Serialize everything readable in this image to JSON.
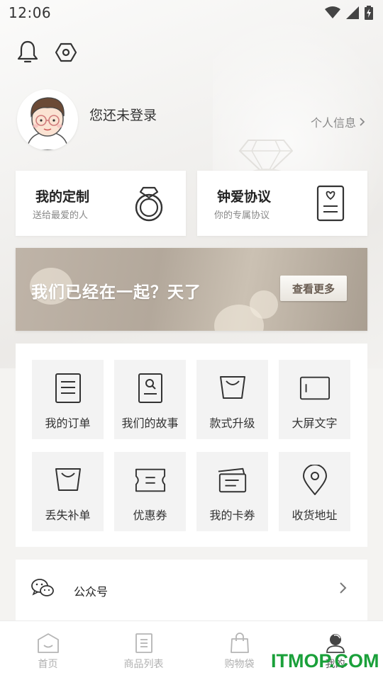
{
  "status_bar": {
    "time": "12:06",
    "icons": [
      "wifi-icon",
      "signal-icon",
      "battery-charging-icon"
    ]
  },
  "header": {
    "icons": [
      "bell-icon",
      "settings-hexagon-icon"
    ]
  },
  "profile": {
    "login_text": "您还未登录",
    "personal_info_label": "个人信息",
    "personal_info_icon": "chevron-right-icon"
  },
  "cards": [
    {
      "title": "我的定制",
      "subtitle": "送给最爱的人",
      "icon": "ring-icon"
    },
    {
      "title": "钟爱协议",
      "subtitle": "你的专属协议",
      "icon": "agreement-doc-icon"
    }
  ],
  "banner": {
    "text": "我们已经在一起？天了",
    "button_label": "查看更多"
  },
  "grid": [
    {
      "label": "我的订单",
      "icon": "order-list-icon"
    },
    {
      "label": "我们的故事",
      "icon": "story-search-icon"
    },
    {
      "label": "款式升级",
      "icon": "bag-upgrade-icon"
    },
    {
      "label": "大屏文字",
      "icon": "screen-text-icon"
    },
    {
      "label": "丢失补单",
      "icon": "bag-reissue-icon"
    },
    {
      "label": "优惠券",
      "icon": "coupon-icon"
    },
    {
      "label": "我的卡券",
      "icon": "card-voucher-icon"
    },
    {
      "label": "收货地址",
      "icon": "location-pin-icon"
    }
  ],
  "wechat": {
    "label": "公众号",
    "icon": "wechat-icon"
  },
  "tabbar": [
    {
      "label": "首页",
      "icon": "home-icon",
      "active": false
    },
    {
      "label": "商品列表",
      "icon": "product-list-icon",
      "active": false
    },
    {
      "label": "购物袋",
      "icon": "shopping-bag-icon",
      "active": false
    },
    {
      "label": "我的",
      "icon": "profile-icon",
      "active": true
    }
  ],
  "watermark": "ITMOP.COM",
  "colors": {
    "accent_brown": "#6a5d52",
    "watermark_green": "#1aa03a",
    "icon_dark": "#333333"
  }
}
